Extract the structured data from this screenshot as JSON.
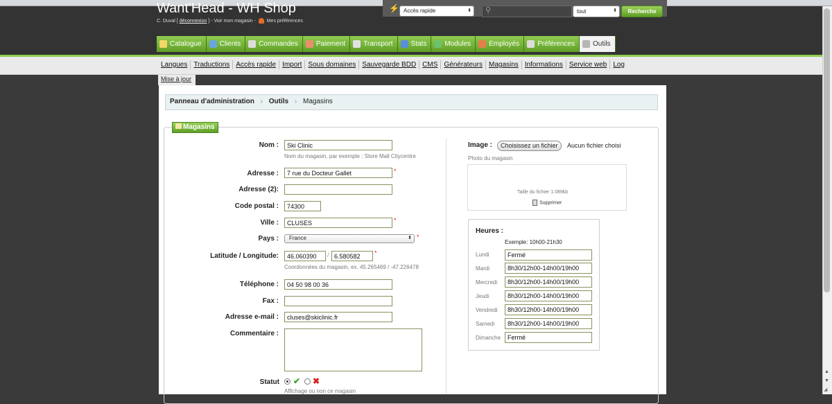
{
  "header": {
    "title": "Want'Head - WH Shop",
    "user_name": "C. Duval [",
    "logout": "déconnexion",
    "user_sep": "] - Voir mon magasin - ",
    "prefs": "Mes préférences",
    "quick_access": "Accès rapide",
    "search_scope": "tout",
    "search_button": "Recherche"
  },
  "tabs": [
    {
      "label": "Catalogue",
      "icon": "folder-icon",
      "color": "#f3d768"
    },
    {
      "label": "Clients",
      "icon": "users-icon",
      "color": "#6aa6dd"
    },
    {
      "label": "Commandes",
      "icon": "cart-icon",
      "color": "#dddddd"
    },
    {
      "label": "Paiement",
      "icon": "payment-icon",
      "color": "#ea8f6e"
    },
    {
      "label": "Transport",
      "icon": "truck-icon",
      "color": "#e1e1e1"
    },
    {
      "label": "Stats",
      "icon": "chart-icon",
      "color": "#5b8fd6"
    },
    {
      "label": "Modules",
      "icon": "puzzle-icon",
      "color": "#6dc16d"
    },
    {
      "label": "Employés",
      "icon": "employee-icon",
      "color": "#e67e4b"
    },
    {
      "label": "Préférences",
      "icon": "preferences-icon",
      "color": "#dcdcdc"
    },
    {
      "label": "Outils",
      "icon": "wrench-icon",
      "color": "#b6b6b6"
    }
  ],
  "subnav": [
    "Langues",
    "Traductions",
    "Accès rapide",
    "Import",
    "Sous domaines",
    "Sauvegarde BDD",
    "CMS",
    "Générateurs",
    "Magasins",
    "Informations",
    "Service web",
    "Log"
  ],
  "update_link": "Mise à jour",
  "breadcrumb": {
    "root": "Panneau d'administration",
    "section": "Outils",
    "current": "Magasins"
  },
  "form": {
    "legend": "Magasins",
    "name_label": "Nom :",
    "name_value": "Ski Clinic",
    "name_hint": "Nom du magasin, par exemple : Store Mall Citycentre",
    "address_label": "Adresse :",
    "address_value": "7 rue du Docteur Gallet",
    "address2_label": "Adresse (2):",
    "address2_value": "",
    "postcode_label": "Code postal :",
    "postcode_value": "74300",
    "city_label": "Ville :",
    "city_value": "CLUSES",
    "country_label": "Pays :",
    "country_value": "France",
    "latlng_label": "Latitude / Longitude:",
    "lat_value": "46.060390",
    "lng_value": "6.580582",
    "latlng_hint": "Coordonnées du magasin, ex. 45.265469 / -47.226478",
    "phone_label": "Téléphone :",
    "phone_value": "04 50 98 00 36",
    "fax_label": "Fax :",
    "fax_value": "",
    "email_label": "Adresse e-mail :",
    "email_value": "cluses@skiclinic.fr",
    "comment_label": "Commentaire :",
    "status_label": "Statut",
    "status_hint": "Affichage ou non ce magasin",
    "required_mark": "*",
    "latlng_sep": "/"
  },
  "image": {
    "label": "Image :",
    "button": "Choisissez un fichier",
    "no_file": "Aucun fichier choisi",
    "hint": "Photo du magasin",
    "filesize": "Taille du fichier 1.089kb",
    "delete": "Supprimer"
  },
  "hours": {
    "title": "Heures :",
    "example": "Exemple: 10h00-21h30",
    "days": [
      {
        "day": "Lundi",
        "value": "Fermé"
      },
      {
        "day": "Mardi",
        "value": "8h30/12h00-14h00/19h00"
      },
      {
        "day": "Mercredi",
        "value": "8h30/12h00-14h00/19h00"
      },
      {
        "day": "Jeudi",
        "value": "8h30/12h00-14h00/19h00"
      },
      {
        "day": "Vendredi",
        "value": "8h30/12h00-14h00/19h00"
      },
      {
        "day": "Samedi",
        "value": "8h30/12h00-14h00/19h00"
      },
      {
        "day": "Dimanche",
        "value": "Fermé"
      }
    ]
  }
}
